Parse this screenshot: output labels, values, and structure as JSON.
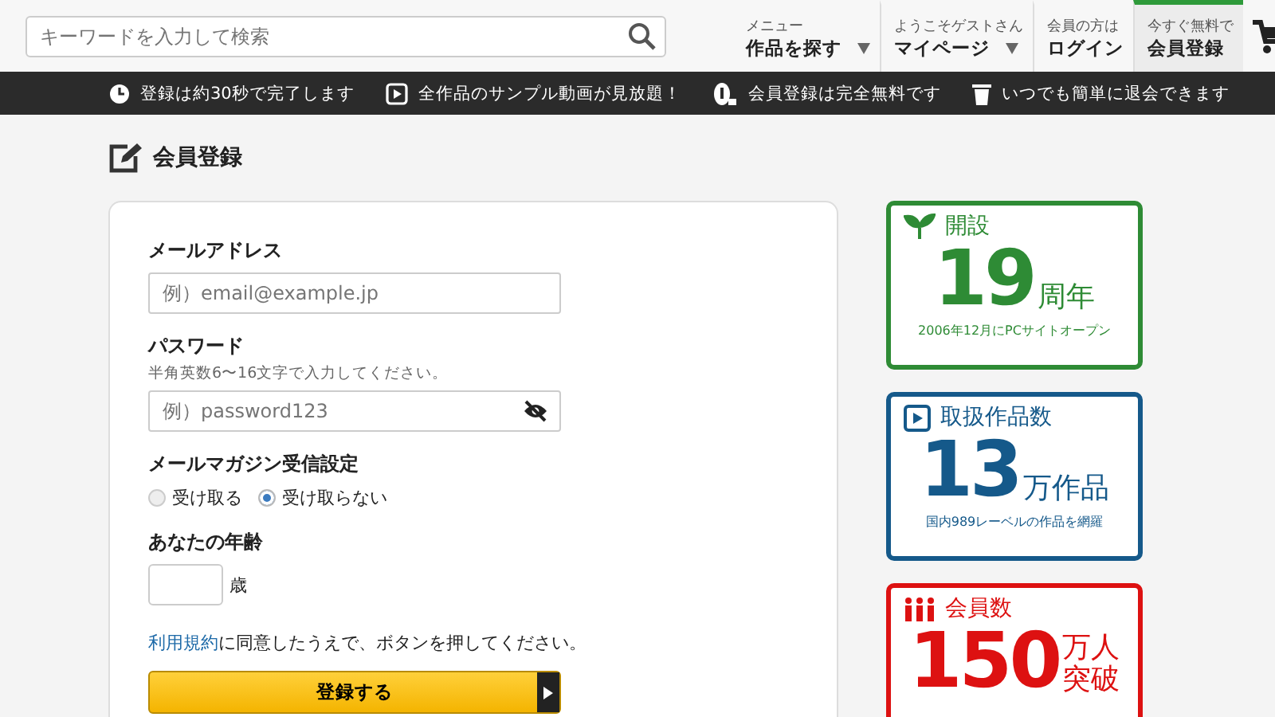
{
  "header": {
    "search": {
      "placeholder": "キーワードを入力して検索"
    },
    "nav": [
      {
        "caption": "メニュー",
        "label": "作品を探す",
        "dropdown": true,
        "selected": false
      },
      {
        "caption": "ようこそゲストさん",
        "label": "マイページ",
        "dropdown": true,
        "selected": false
      },
      {
        "caption": "会員の方は",
        "label": "ログイン",
        "dropdown": false,
        "selected": false
      },
      {
        "caption": "今すぐ無料で",
        "label": "会員登録",
        "dropdown": false,
        "selected": true
      }
    ]
  },
  "benefits": [
    {
      "kind": "clock",
      "text": "登録は約30秒で完了します"
    },
    {
      "kind": "play",
      "text": "全作品のサンプル動画が見放題！"
    },
    {
      "kind": "free",
      "text": "会員登録は完全無料です"
    },
    {
      "kind": "trash",
      "text": "いつでも簡単に退会できます"
    }
  ],
  "page_title": "会員登録",
  "form": {
    "email": {
      "label": "メールアドレス",
      "placeholder": "例）email@example.jp"
    },
    "password": {
      "label": "パスワード",
      "hint": "半角英数6〜16文字で入力してください。",
      "placeholder": "例）password123"
    },
    "newsletter": {
      "label": "メールマガジン受信設定",
      "options": [
        {
          "label": "受け取る",
          "selected": false
        },
        {
          "label": "受け取らない",
          "selected": true
        }
      ]
    },
    "age": {
      "label": "あなたの年齢",
      "unit": "歳"
    },
    "terms": {
      "link": "利用規約",
      "text": "に同意したうえで、ボタンを押してください。"
    },
    "submit": "登録する"
  },
  "stats": [
    {
      "kind": "sprout",
      "color": "#2e8b35",
      "title": "開設",
      "number": "19",
      "unit": [
        "周年"
      ],
      "note": "2006年12月にPCサイトオープン"
    },
    {
      "kind": "play",
      "color": "#15598a",
      "title": "取扱作品数",
      "number": "13",
      "unit": [
        "万作品"
      ],
      "note": "国内989レーベルの作品を網羅"
    },
    {
      "kind": "people",
      "color": "#dd1111",
      "title": "会員数",
      "number": "150",
      "unit": [
        "万人",
        "突破"
      ]
    }
  ]
}
